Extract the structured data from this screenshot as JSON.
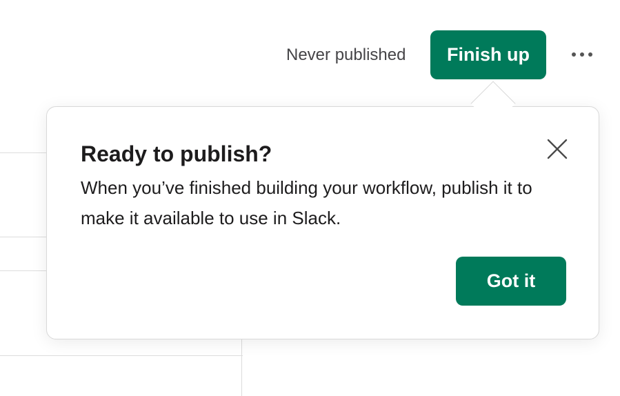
{
  "toolbar": {
    "status": "Never published",
    "finish_label": "Finish up",
    "more_icon": "more-horizontal-icon"
  },
  "popover": {
    "title": "Ready to publish?",
    "body": "When you’ve finished building your workflow, publish it to make it available to use in Slack.",
    "confirm_label": "Got it",
    "close_icon": "close-icon"
  },
  "colors": {
    "primary": "#007a5a",
    "text": "#1d1c1d",
    "muted": "#454447"
  }
}
